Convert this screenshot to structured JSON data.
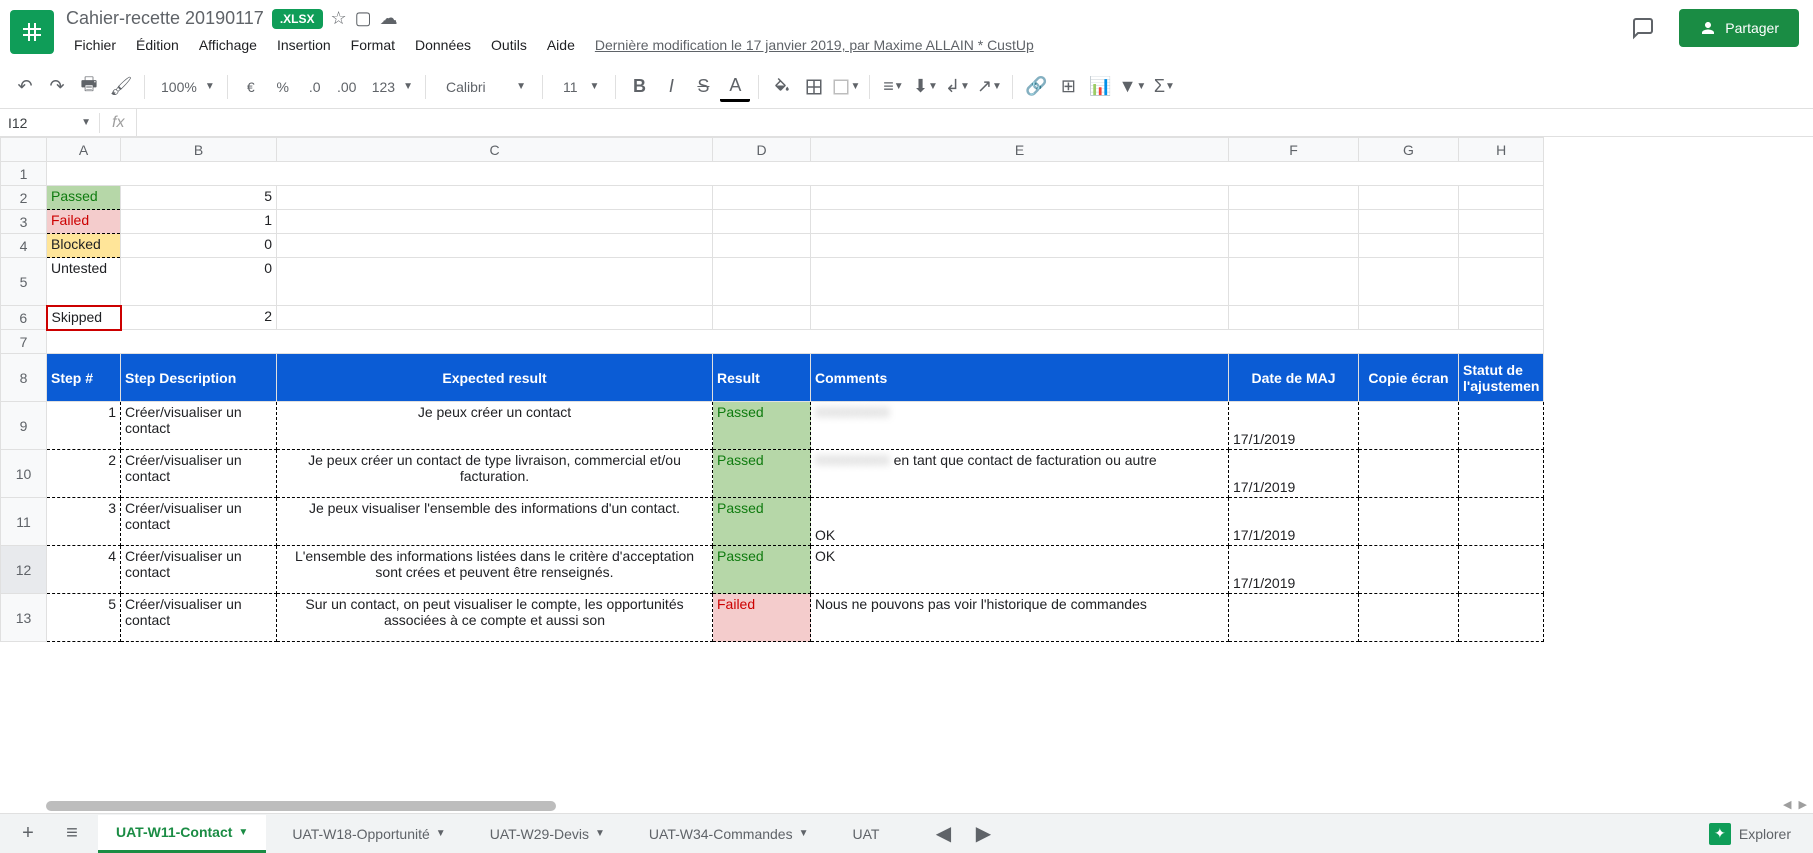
{
  "doc": {
    "title_full": "Cahier-recette         20190117",
    "badge": ".XLSX"
  },
  "menus": [
    "Fichier",
    "Édition",
    "Affichage",
    "Insertion",
    "Format",
    "Données",
    "Outils",
    "Aide"
  ],
  "last_modified": "Dernière modification le 17 janvier 2019, par Maxime ALLAIN * CustUp",
  "share_label": "Partager",
  "toolbar": {
    "zoom": "100%",
    "currency": "€",
    "percent": "%",
    "dec_less": ".0",
    "dec_more": ".00",
    "num_format": "123",
    "font": "Calibri",
    "font_size": "11"
  },
  "name_box": "I12",
  "summary": [
    {
      "label": "Passed",
      "count": "5",
      "cls": "passed-bg"
    },
    {
      "label": "Failed",
      "count": "1",
      "cls": "failed-bg"
    },
    {
      "label": "Blocked",
      "count": "0",
      "cls": "blocked-bg"
    },
    {
      "label": "Untested",
      "count": "0",
      "cls": ""
    },
    {
      "label": "Skipped",
      "count": "2",
      "cls": ""
    }
  ],
  "headers": {
    "step_no": "Step #",
    "step_desc": "Step Description",
    "expected": "Expected result",
    "result": "Result",
    "comments": "Comments",
    "date_maj": "Date de MAJ",
    "copie": "Copie écran",
    "statut": "Statut de l'ajustemen"
  },
  "rows": [
    {
      "n": "1",
      "desc": "Créer/visualiser un contact",
      "exp": "Je peux créer un contact",
      "res": "Passed",
      "res_cls": "passed-bg",
      "com": "",
      "date": "17/1/2019"
    },
    {
      "n": "2",
      "desc": "Créer/visualiser un contact",
      "exp": "Je peux créer un contact de type livraison, commercial et/ou facturation.",
      "res": "Passed",
      "res_cls": "passed-bg",
      "com": "                  en tant que contact de facturation ou autre",
      "date": "17/1/2019"
    },
    {
      "n": "3",
      "desc": "Créer/visualiser un contact",
      "exp": "Je peux visualiser l'ensemble des informations d'un contact.",
      "res": "Passed",
      "res_cls": "passed-bg",
      "com": "OK",
      "date": "17/1/2019"
    },
    {
      "n": "4",
      "desc": "Créer/visualiser un contact",
      "exp": "L'ensemble des informations listées dans le critère d'acceptation sont crées et peuvent être renseignés.",
      "res": "Passed",
      "res_cls": "passed-bg",
      "com": "OK",
      "date": "17/1/2019"
    },
    {
      "n": "5",
      "desc": "Créer/visualiser un contact",
      "exp": "Sur un contact, on peut visualiser le compte, les opportunités associées à ce compte et aussi son",
      "res": "Failed",
      "res_cls": "failed-bg",
      "com": "Nous ne pouvons pas voir l'historique de commandes",
      "date": ""
    }
  ],
  "columns": [
    "A",
    "B",
    "C",
    "D",
    "E",
    "F",
    "G",
    "H"
  ],
  "row_nums": [
    "1",
    "2",
    "3",
    "4",
    "5",
    "6",
    "7",
    "8",
    "9",
    "10",
    "11",
    "12",
    "13"
  ],
  "sheet_tabs": [
    {
      "label": "UAT-W11-Contact",
      "active": true
    },
    {
      "label": "UAT-W18-Opportunité",
      "active": false
    },
    {
      "label": "UAT-W29-Devis",
      "active": false
    },
    {
      "label": "UAT-W34-Commandes",
      "active": false
    },
    {
      "label": "UAT",
      "active": false
    }
  ],
  "explorer_label": "Explorer"
}
